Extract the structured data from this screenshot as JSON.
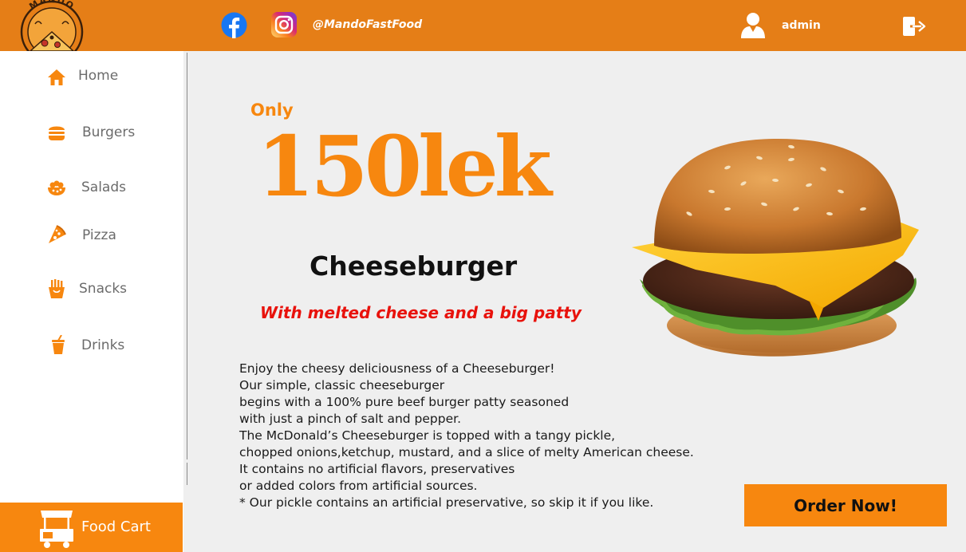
{
  "brand": {
    "logo_text": "MANDO"
  },
  "header": {
    "social_handle": "@MandoFastFood",
    "user_name": "admin",
    "icons": [
      "facebook-icon",
      "instagram-icon",
      "user-icon",
      "logout-icon"
    ]
  },
  "sidebar": {
    "items": [
      {
        "label": "Home",
        "icon": "home-icon"
      },
      {
        "label": "Burgers",
        "icon": "burger-icon"
      },
      {
        "label": "Salads",
        "icon": "salad-icon"
      },
      {
        "label": "Pizza",
        "icon": "pizza-icon"
      },
      {
        "label": "Snacks",
        "icon": "fries-icon"
      },
      {
        "label": "Drinks",
        "icon": "drink-icon"
      }
    ],
    "cart": {
      "label": "Food Cart",
      "icon": "food-cart-icon"
    }
  },
  "product": {
    "price_prefix": "Only",
    "price": "150lek",
    "name": "Cheeseburger",
    "tagline": "With melted cheese and a big patty",
    "description": [
      "Enjoy the cheesy deliciousness of a Cheeseburger!",
      "Our simple, classic cheeseburger",
      "begins with a 100% pure beef burger patty seasoned",
      "with just a pinch of salt and pepper.",
      "The McDonald’s Cheeseburger is topped with a tangy pickle,",
      "chopped onions,ketchup, mustard, and a slice of melty American cheese.",
      "It contains no artificial flavors, preservatives",
      "or added colors from artificial sources.",
      "* Our pickle contains an artificial preservative, so skip it if you like."
    ],
    "order_label": "Order Now!"
  },
  "colors": {
    "header_bg": "#e57e17",
    "accent": "#f7870f",
    "tagline": "#e8120c",
    "content_bg": "#efefef"
  }
}
